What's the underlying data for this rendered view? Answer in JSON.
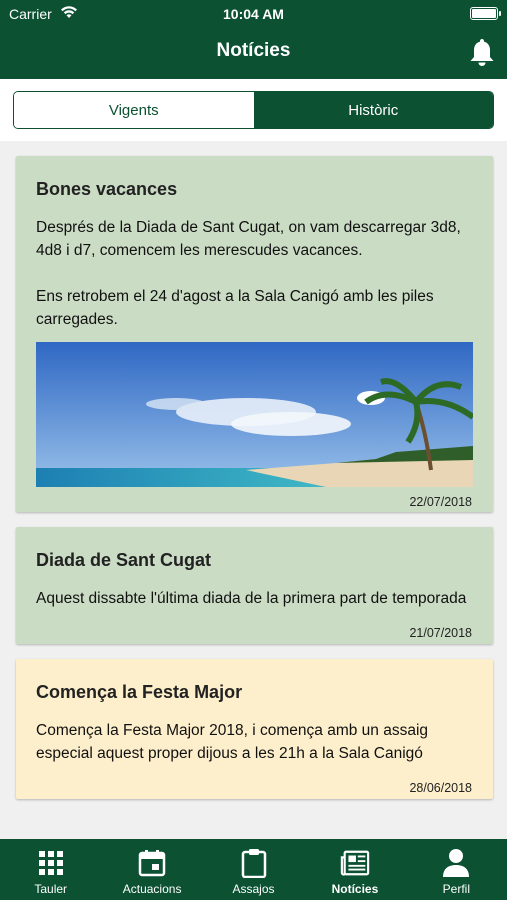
{
  "status_bar": {
    "carrier": "Carrier",
    "time": "10:04 AM"
  },
  "header": {
    "title": "Notícies"
  },
  "segments": [
    {
      "label": "Vigents"
    },
    {
      "label": "Històric"
    }
  ],
  "news": [
    {
      "title": "Bones vacances",
      "body": "Després de la Diada de Sant Cugat, on vam descarregar 3d8, 4d8 i d7, comencem les merescudes vacances.\n\nEns retrobem el 24 d'agost a la Sala Canigó amb les piles carregades.",
      "date": "22/07/2018"
    },
    {
      "title": "Diada de Sant Cugat",
      "body": "Aquest dissabte l'última diada de la primera part de temporada",
      "date": "21/07/2018"
    },
    {
      "title": "Comença la Festa Major",
      "body": "Comença la Festa Major 2018, i comença amb un assaig especial aquest proper dijous a les 21h a la Sala Canigó",
      "date": "28/06/2018"
    }
  ],
  "tabbar": [
    {
      "label": "Tauler",
      "icon": "grid-icon"
    },
    {
      "label": "Actuacions",
      "icon": "calendar-icon"
    },
    {
      "label": "Assajos",
      "icon": "clipboard-icon"
    },
    {
      "label": "Notícies",
      "icon": "newspaper-icon"
    },
    {
      "label": "Perfil",
      "icon": "person-icon"
    }
  ],
  "colors": {
    "primary": "#0b5132",
    "card_green": "#cbdcc5",
    "card_yellow": "#fdefcb"
  }
}
